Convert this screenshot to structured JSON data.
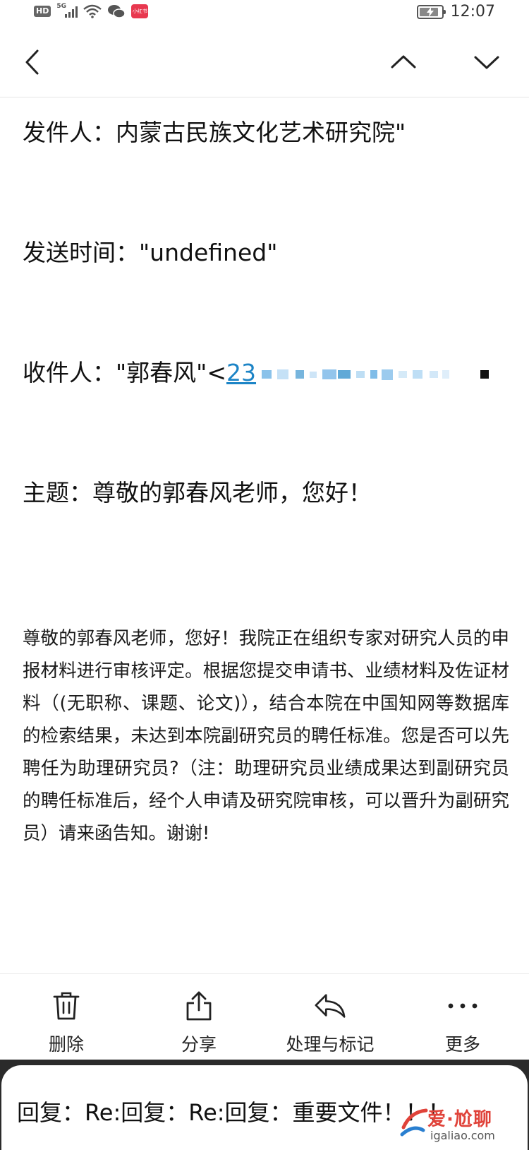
{
  "status_bar": {
    "hd": "HD",
    "network": "5G",
    "app_badge": "小红书",
    "time": "12:07"
  },
  "email": {
    "sender_label": "发件人：",
    "sender_value": "内蒙古民族文化艺术研究院\"",
    "time_label": "发送时间：",
    "time_value": "\"undefined\"",
    "recipient_label": "收件人：",
    "recipient_name": "\"郭春风\"<",
    "recipient_email_visible": "23",
    "subject_label": "主题：",
    "subject_value": "尊敬的郭春风老师，您好！",
    "body": "尊敬的郭春风老师，您好！我院正在组织专家对研究人员的申报材料进行审核评定。根据您提交申请书、业绩材料及佐证材料（(无职称、课题、论文)），结合本院在中国知网等数据库的检索结果，未达到本院副研究员的聘任标准。您是否可以先聘任为助理研究员?（注：助理研究员业绩成果达到副研究员的聘任标准后，经个人申请及研究院审核，可以晋升为副研究员）请来函告知。谢谢!"
  },
  "toolbar": {
    "delete_label": "删除",
    "share_label": "分享",
    "process_label": "处理与标记",
    "more_label": "更多"
  },
  "reply_bar": {
    "text": "回复：Re:回复：Re:回复：重要文件！！！"
  },
  "watermark": {
    "main": "爱·尬聊",
    "sub": "igaliao.com"
  },
  "colors": {
    "link": "#1c84c6",
    "text": "#111111",
    "watermark_red": "#e0433a"
  }
}
